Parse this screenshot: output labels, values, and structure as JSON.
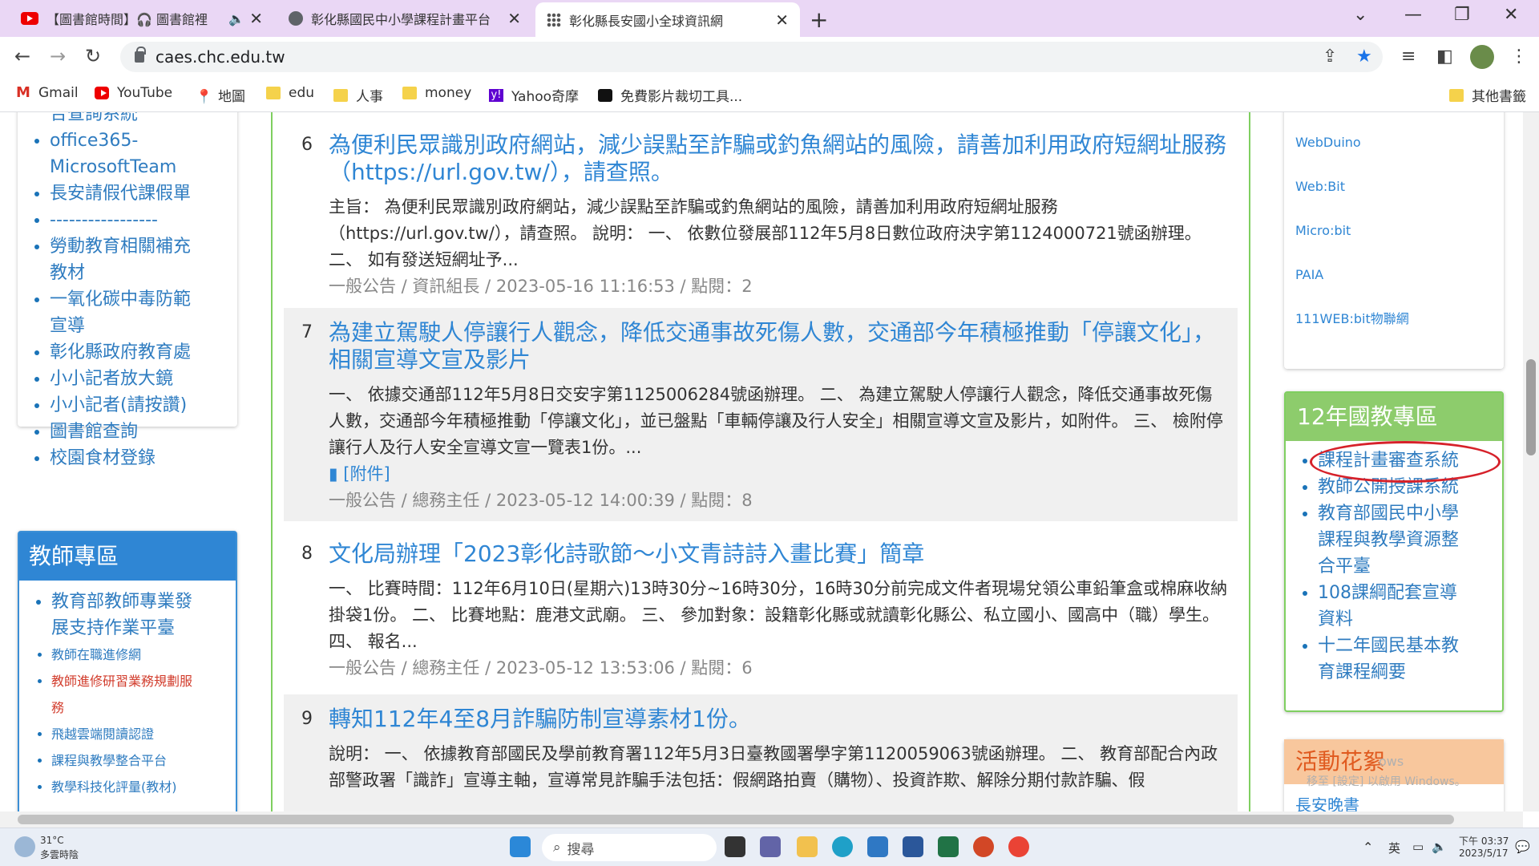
{
  "tabs": [
    {
      "title": "【圖書館時間】🎧 圖書館裡"
    },
    {
      "title": "彰化縣國民中小學課程計畫平台"
    },
    {
      "title": "彰化縣長安國小全球資訊網"
    }
  ],
  "url": "caes.chc.edu.tw",
  "bookmarks": [
    "Gmail",
    "YouTube",
    "地圖",
    "edu",
    "人事",
    "money",
    "Yahoo奇摩",
    "免費影片裁切工具...",
    "其他書籤"
  ],
  "left_links": [
    "合查詢系統",
    "office365-",
    "MicrosoftTeam",
    "長安請假代課假單",
    "-----------------",
    "勞動教育相關補充",
    "教材",
    "一氧化碳中毒防範",
    "宣導",
    "彰化縣政府教育處",
    "小小記者放大鏡",
    "小小記者(請按讚)",
    "圖書館查詢",
    "校園食材登錄"
  ],
  "teacher": {
    "heading": "教師專區",
    "links": [
      "教育部教師專業發",
      "展支持作業平臺",
      "教師在職進修網",
      "教師進修研習業務規劃服",
      "務",
      "飛越雲端閱讀認證",
      "課程與教學整合平台",
      "教學科技化評量(教材)"
    ]
  },
  "news": [
    {
      "num": "6",
      "title": "為便利民眾識別政府網站，減少誤點至詐騙或釣魚網站的風險，請善加利用政府短網址服務（https://url.gov.tw/），請查照。",
      "body": "主旨： 為便利民眾識別政府網站，減少誤點至詐騙或釣魚網站的風險，請善加利用政府短網址服務（https://url.gov.tw/），請查照。 說明： 一、 依數位發展部112年5月8日數位政府決字第1124000721號函辦理。 二、 如有發送短網址予...",
      "meta": "一般公告 / 資訊組長 / 2023-05-16 11:16:53 / 點閱：2"
    },
    {
      "num": "7",
      "title": "為建立駕駛人停讓行人觀念，降低交通事故死傷人數，交通部今年積極推動「停讓文化」，相關宣導文宣及影片",
      "body": "一、 依據交通部112年5月8日交安字第1125006284號函辦理。 二、 為建立駕駛人停讓行人觀念，降低交通事故死傷人數，交通部今年積極推動「停讓文化」，並已盤點「車輛停讓及行人安全」相關宣導文宣及影片，如附件。 三、 檢附停讓行人及行人安全宣導文宣一覽表1份。...",
      "attachment": "[附件]",
      "meta": "一般公告 / 總務主任 / 2023-05-12 14:00:39 / 點閱：8"
    },
    {
      "num": "8",
      "title": "文化局辦理「2023彰化詩歌節～小文青詩詩入畫比賽」簡章",
      "body": "一、 比賽時間：112年6月10日(星期六)13時30分~16時30分，16時30分前完成文件者現場兌領公車鉛筆盒或棉麻收納掛袋1份。 二、 比賽地點：鹿港文武廟。 三、 參加對象：設籍彰化縣或就讀彰化縣公、私立國小、國高中（職）學生。 四、 報名...",
      "meta": "一般公告 / 總務主任 / 2023-05-12 13:53:06 / 點閱：6"
    },
    {
      "num": "9",
      "title": "轉知112年4至8月詐騙防制宣導素材1份。",
      "body": "說明： 一、 依據教育部國民及學前教育署112年5月3日臺教國署學字第1120059063號函辦理。 二、 教育部配合內政部警政署「識詐」宣導主軸，宣導常見詐騙手法包括：假網路拍賣（購物）、投資詐欺、解除分期付款詐騙、假"
    }
  ],
  "right_links": [
    "WebDuino",
    "Web:Bit",
    "Micro:bit",
    "PAIA",
    "111WEB:bit物聯網"
  ],
  "edu12": {
    "heading": "12年國教專區",
    "links": [
      "課程計畫審查系統",
      "教師公開授課系統",
      "教育部國民中小學",
      "課程與教學資源整",
      "合平臺",
      "108課綱配套宣導",
      "資料",
      "十二年國民基本教",
      "育課程綱要"
    ]
  },
  "activity": {
    "heading": "活動花絮",
    "sub": "長安晚書"
  },
  "watermark": {
    "line1": "ows",
    "line2": "移至 [設定] 以啟用 Windows。"
  },
  "taskbar": {
    "weather_temp": "31°C",
    "weather_desc": "多雲時陰",
    "search": "搜尋",
    "lang": "英",
    "time": "下午 03:37",
    "date": "2023/5/17"
  }
}
